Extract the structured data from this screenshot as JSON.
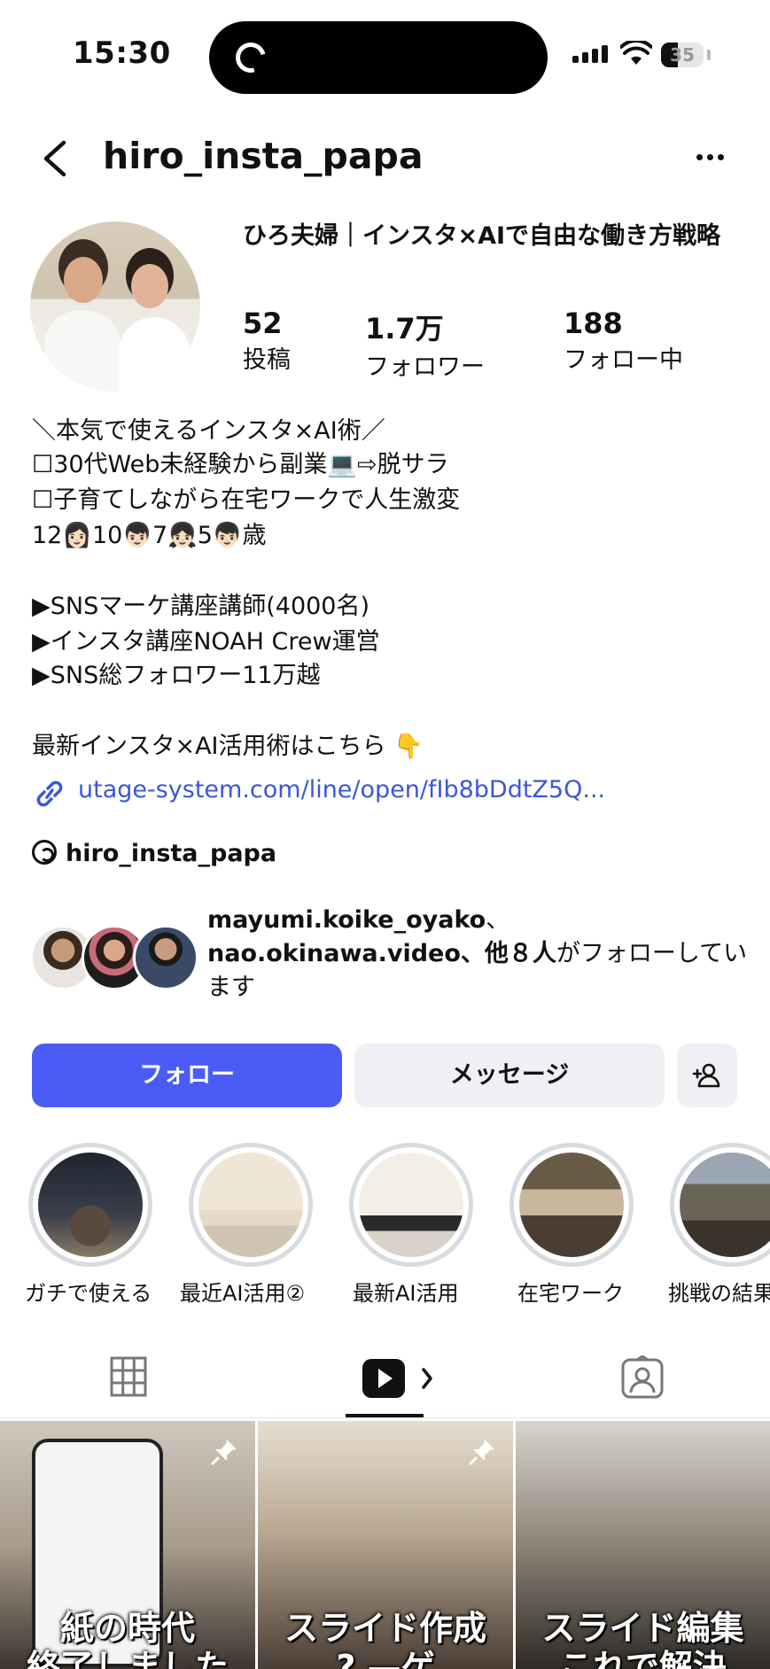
{
  "status_bar": {
    "time": "15:30",
    "battery": "35"
  },
  "header": {
    "username": "hiro_insta_papa"
  },
  "profile": {
    "display_name": "ひろ夫婦｜インスタ×AIで自由な働き方戦略",
    "stats": [
      {
        "value": "52",
        "label": "投稿"
      },
      {
        "value": "1.7万",
        "label": "フォロワー"
      },
      {
        "value": "188",
        "label": "フォロー中"
      }
    ]
  },
  "bio": {
    "line1": "＼本気で使えるインスタ×AI術／",
    "line2": "☐30代Web未経験から副業💻⇨脱サラ",
    "line3": "☐子育てしながら在宅ワークで人生激変",
    "line4": "12👩🏻10👦🏻7👧🏻5👦🏻歳",
    "line5": "▶SNSマーケ講座講師(4000名)",
    "line6": "▶インスタ講座NOAH Crew運営",
    "line7": "▶SNS総フォロワー11万越",
    "line8": "最新インスタ×AI活用術はこちら 👇",
    "link": "utage-system.com/line/open/fIb8bDdtZ5Q...",
    "threads_handle": "hiro_insta_papa"
  },
  "followed_by": {
    "user1": "mayumi.koike_oyako",
    "sep": "、",
    "user2": "nao.okinawa.video",
    "others": "、他８人",
    "suffix": "がフォローしています"
  },
  "actions": {
    "follow": "フォロー",
    "message": "メッセージ"
  },
  "highlights": [
    {
      "label": "ガチで使える"
    },
    {
      "label": "最近AI活用②"
    },
    {
      "label": "最新AI活用"
    },
    {
      "label": "在宅ワーク"
    },
    {
      "label": "挑戦の結果"
    }
  ],
  "posts": [
    {
      "caption_line1": "紙の時代",
      "caption_line2": "終了しました"
    },
    {
      "caption_line1": "スライド作成",
      "caption_line2": "? —ゲ"
    },
    {
      "caption_line1": "スライド編集",
      "caption_line2": "これで解決"
    }
  ]
}
